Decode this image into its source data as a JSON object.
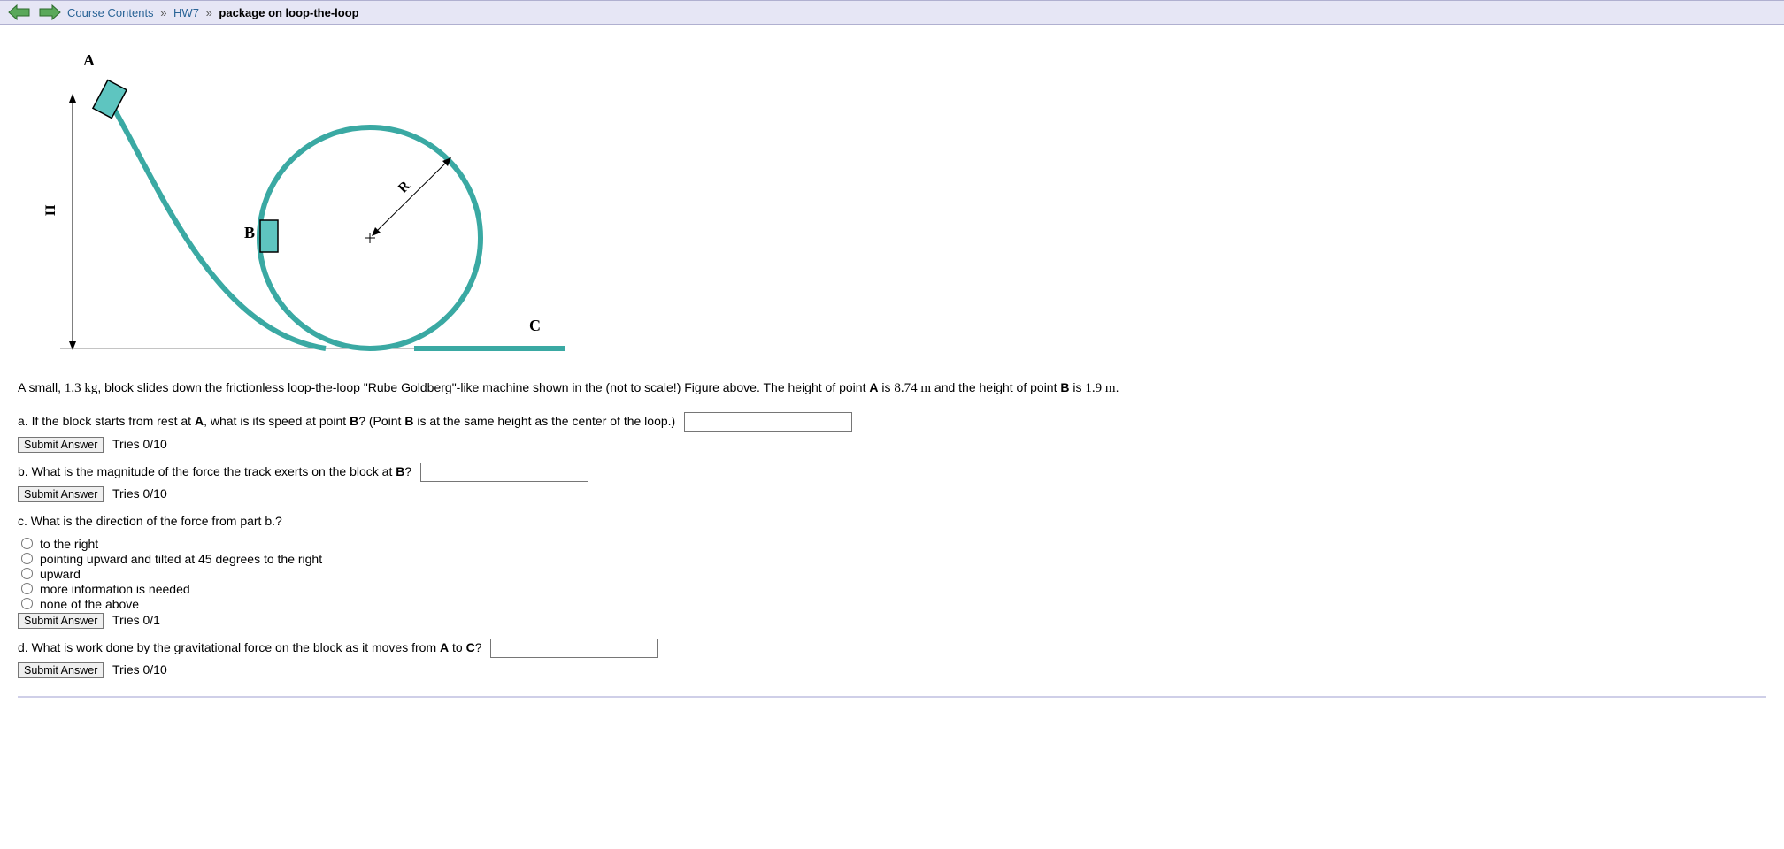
{
  "breadcrumb": {
    "course_contents": "Course Contents",
    "sep": "»",
    "hw": "HW7",
    "current": "package on loop-the-loop"
  },
  "diagram": {
    "label_A": "A",
    "label_B": "B",
    "label_C": "C",
    "label_H": "H",
    "label_R": "R"
  },
  "problem": {
    "intro_prefix": "A small, ",
    "mass": "1.3 kg",
    "intro_mid": ", block slides down the frictionless loop-the-loop \"Rube Goldberg\"-like machine shown in the (not to scale!) Figure above. The height of point ",
    "A": "A",
    "intro_is": " is ",
    "heightA": "8.74 m",
    "intro_and": " and the height of point ",
    "B": "B",
    "intro_bis": " is ",
    "heightB": "1.9 m",
    "period": "."
  },
  "parts": {
    "a_prefix": "a. If the block starts from rest at ",
    "a_mid": ", what is its speed at point ",
    "a_suffix": "? (Point ",
    "a_end": " is at the same height as the center of the loop.)",
    "b_text_prefix": "b. What is the magnitude of the force the track exerts on the block at ",
    "b_q": "?",
    "c_text": "c. What is the direction of the force from part b.?",
    "c_options": [
      "to the right",
      "pointing upward and tilted at 45 degrees to the right",
      "upward",
      "more information is needed",
      "none of the above"
    ],
    "d_text_prefix": "d. What is work done by the gravitational force on the block as it moves from ",
    "d_to": " to ",
    "d_q": "?"
  },
  "buttons": {
    "submit": "Submit Answer"
  },
  "tries": {
    "a": "Tries 0/10",
    "b": "Tries 0/10",
    "c": "Tries 0/1",
    "d": "Tries 0/10"
  },
  "labels": {
    "A": "A",
    "B": "B",
    "C": "C"
  }
}
